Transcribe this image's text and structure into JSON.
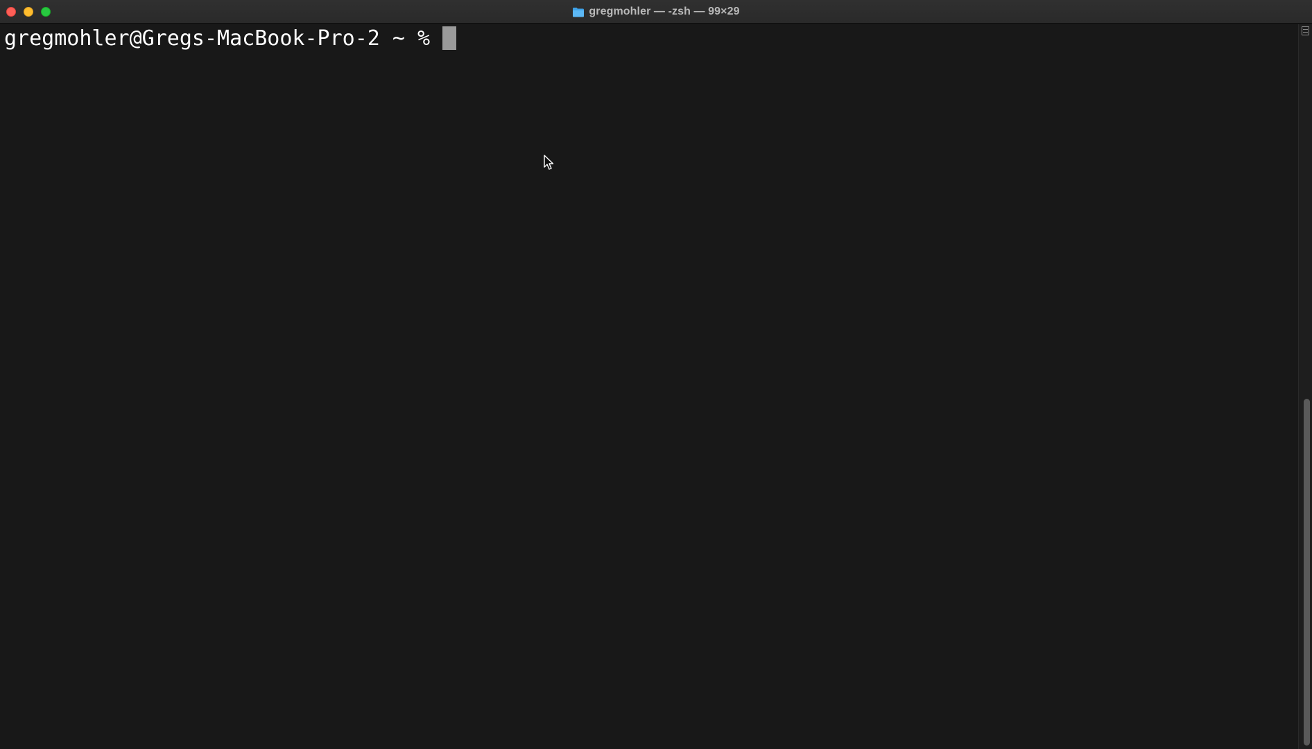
{
  "window": {
    "title": "gregmohler — -zsh — 99×29",
    "title_icon": "folder-icon",
    "controls": {
      "close_color": "#fe5f57",
      "minimize_color": "#febc2e",
      "zoom_color": "#28c840"
    }
  },
  "terminal": {
    "prompt": "gregmohler@Gregs-MacBook-Pro-2 ~ % ",
    "background_color": "#181818",
    "text_color": "#ffffff",
    "cursor_color": "#9a9a9a"
  },
  "icons": {
    "scrollback_icon": "scroll-marks-icon",
    "mouse_pointer": "pointer-icon"
  }
}
